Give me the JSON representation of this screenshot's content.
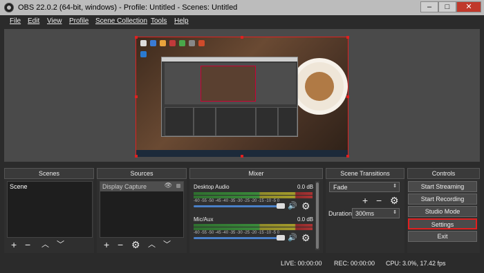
{
  "window": {
    "title": "OBS 22.0.2 (64-bit, windows) - Profile: Untitled - Scenes: Untitled",
    "minimize": "–",
    "maximize": "□",
    "close": "✕"
  },
  "menu": [
    "File",
    "Edit",
    "View",
    "Profile",
    "Scene Collection",
    "Tools",
    "Help"
  ],
  "docks": {
    "scenes": "Scenes",
    "sources": "Sources",
    "mixer": "Mixer",
    "transitions": "Scene Transitions",
    "controls": "Controls"
  },
  "scenes": {
    "items": [
      "Scene"
    ]
  },
  "sources": {
    "items": [
      "Display Capture"
    ]
  },
  "mixer": {
    "channels": [
      {
        "name": "Desktop Audio",
        "level": "0.0 dB",
        "volume": 1.0
      },
      {
        "name": "Mic/Aux",
        "level": "0.0 dB",
        "volume": 1.0
      }
    ],
    "scale": "-60 -55 -50 -45 -40 -35 -30 -25 -20 -15 -10 -5 0"
  },
  "transitions": {
    "selected": "Fade",
    "duration_label": "Duration",
    "duration": "300ms"
  },
  "controls": [
    "Start Streaming",
    "Start Recording",
    "Studio Mode",
    "Settings",
    "Exit"
  ],
  "highlight_color": "#e02020",
  "status": {
    "live": "LIVE: 00:00:00",
    "rec": "REC: 00:00:00",
    "cpu": "CPU: 3.0%, 17.42 fps"
  },
  "icons": {
    "add": "+",
    "remove": "−",
    "up": "︿",
    "down": "﹀",
    "gear": "⚙",
    "speaker": "🔊",
    "eye": "👁"
  }
}
